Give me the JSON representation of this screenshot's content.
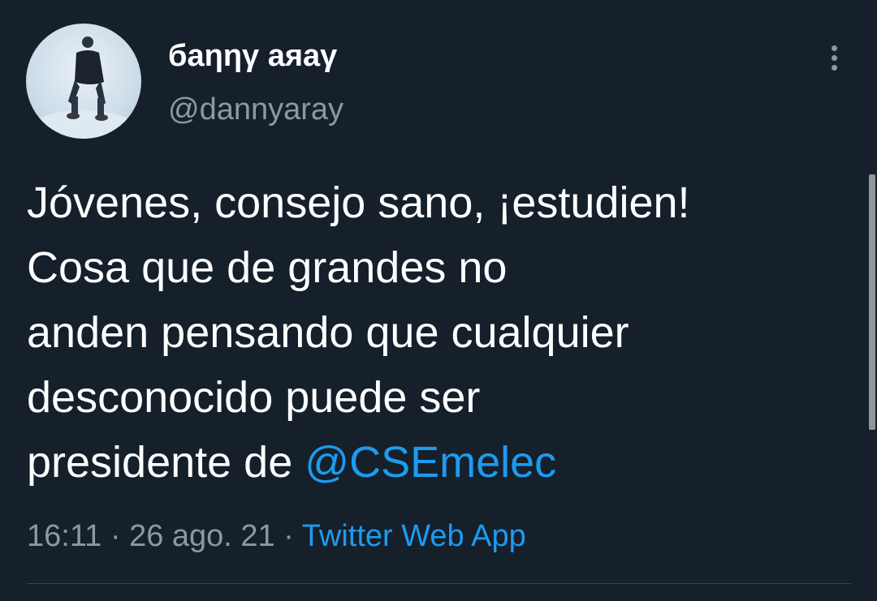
{
  "tweet": {
    "author": {
      "display_name": "бaηηγ aяaγ",
      "handle": "@dannyaray"
    },
    "text_lines": [
      "Jóvenes, consejo sano, ¡estudien!",
      "Cosa que de grandes no",
      "anden pensando que cualquier",
      "desconocido puede ser"
    ],
    "last_line_prefix": "presidente de ",
    "mention": "@CSEmelec",
    "time": "16:11",
    "separator": " · ",
    "date": "26 ago. 21",
    "source": "Twitter Web App"
  },
  "icons": {
    "more": "more-vertical-icon"
  },
  "colors": {
    "background": "#15202b",
    "text_primary": "#ffffff",
    "text_secondary": "#8b98a5",
    "accent": "#1d9bf0",
    "divider": "#38444d"
  }
}
